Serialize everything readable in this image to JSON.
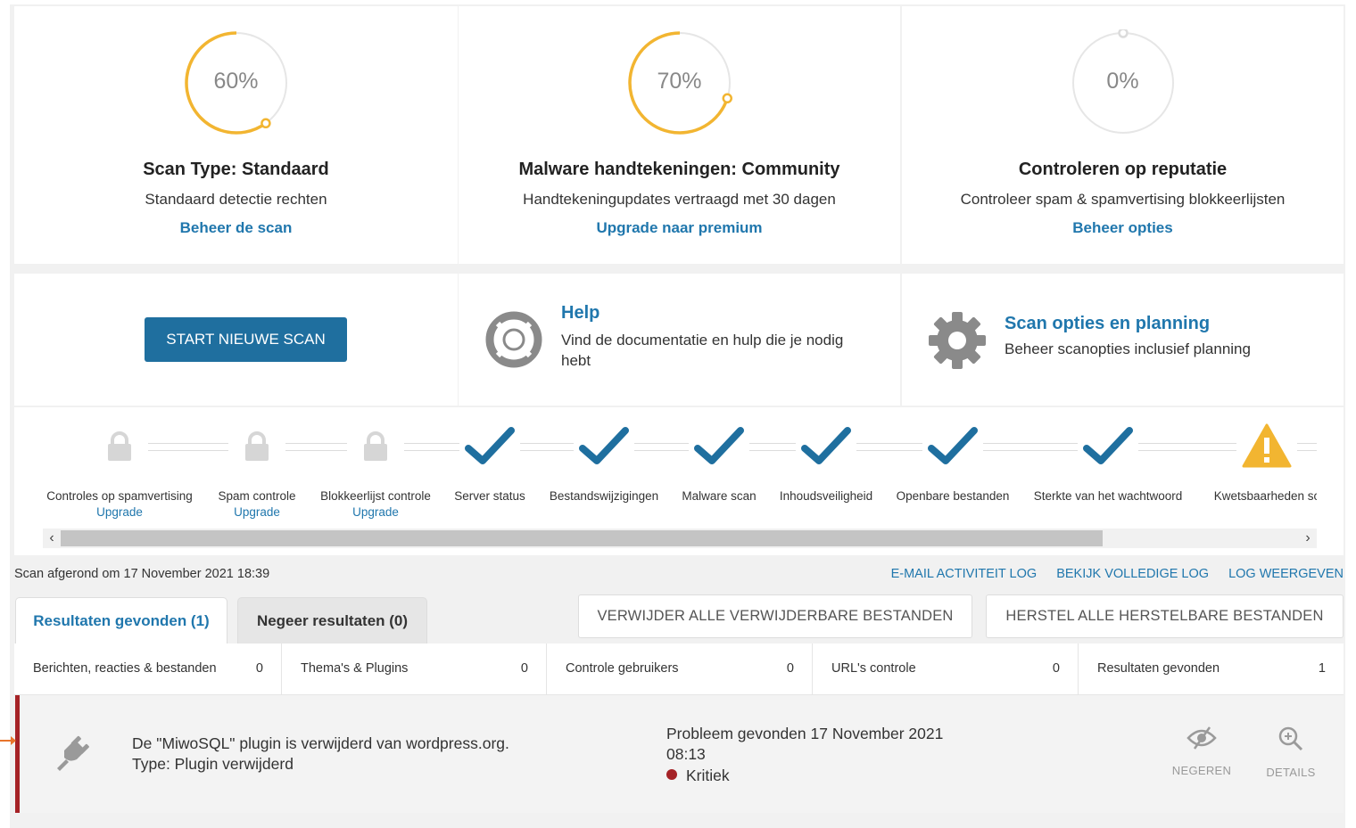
{
  "colors": {
    "accent": "#2077ad",
    "gauge": "#f2b531",
    "critical": "#a52226",
    "button": "#1f6f9f"
  },
  "gauges": [
    {
      "percent": 60,
      "percent_label": "60%",
      "title": "Scan Type: Standaard",
      "subtitle": "Standaard detectie rechten",
      "link": "Beheer de scan"
    },
    {
      "percent": 70,
      "percent_label": "70%",
      "title": "Malware handtekeningen: Community",
      "subtitle": "Handtekeningupdates vertraagd met 30 dagen",
      "link": "Upgrade naar premium"
    },
    {
      "percent": 0,
      "percent_label": "0%",
      "title": "Controleren op reputatie",
      "subtitle": "Controleer spam & spamvertising blokkeerlijsten",
      "link": "Beheer opties"
    }
  ],
  "actions": {
    "start_button": "START NIEUWE SCAN",
    "help": {
      "icon": "lifebuoy-icon",
      "title": "Help",
      "description": "Vind de documentatie en hulp die je nodig hebt"
    },
    "schedule": {
      "icon": "gear-icon",
      "title": "Scan opties en planning",
      "description": "Beheer scanopties inclusief planning"
    }
  },
  "steps": [
    {
      "label": "Controles op spamvertising",
      "status": "locked",
      "link": "Upgrade"
    },
    {
      "label": "Spam controle",
      "status": "locked",
      "link": "Upgrade"
    },
    {
      "label": "Blokkeerlijst controle",
      "status": "locked",
      "link": "Upgrade"
    },
    {
      "label": "Server status",
      "status": "done"
    },
    {
      "label": "Bestandswijzigingen",
      "status": "done"
    },
    {
      "label": "Malware scan",
      "status": "done"
    },
    {
      "label": "Inhoudsveiligheid",
      "status": "done"
    },
    {
      "label": "Openbare bestanden",
      "status": "done"
    },
    {
      "label": "Sterkte van het wachtwoord",
      "status": "done"
    },
    {
      "label": "Kwetsbaarheden sc",
      "status": "warning"
    }
  ],
  "status": {
    "scan_finished": "Scan afgerond om 17 November 2021 18:39",
    "log_links": [
      "E-MAIL ACTIVITEIT LOG",
      "BEKIJK VOLLEDIGE LOG",
      "LOG WEERGEVEN"
    ]
  },
  "tabs": [
    {
      "label": "Resultaten gevonden (1)",
      "active": true
    },
    {
      "label": "Negeer resultaten (0)",
      "active": false
    }
  ],
  "bulk_actions": {
    "delete": "VERWIJDER ALLE VERWIJDERBARE BESTANDEN",
    "repair": "HERSTEL ALLE HERSTELBARE BESTANDEN"
  },
  "counts": [
    {
      "label": "Berichten, reacties & bestanden",
      "value": "0"
    },
    {
      "label": "Thema's & Plugins",
      "value": "0"
    },
    {
      "label": "Controle gebruikers",
      "value": "0"
    },
    {
      "label": "URL's controle",
      "value": "0"
    },
    {
      "label": "Resultaten gevonden",
      "value": "1"
    }
  ],
  "result": {
    "icon": "plug-icon",
    "message": "De \"MiwoSQL\" plugin is verwijderd van wordpress.org.",
    "type": "Type: Plugin verwijderd",
    "found": "Probleem gevonden 17 November 2021 08:13",
    "severity": "Kritiek",
    "ignore_label": "NEGEREN",
    "details_label": "DETAILS"
  }
}
